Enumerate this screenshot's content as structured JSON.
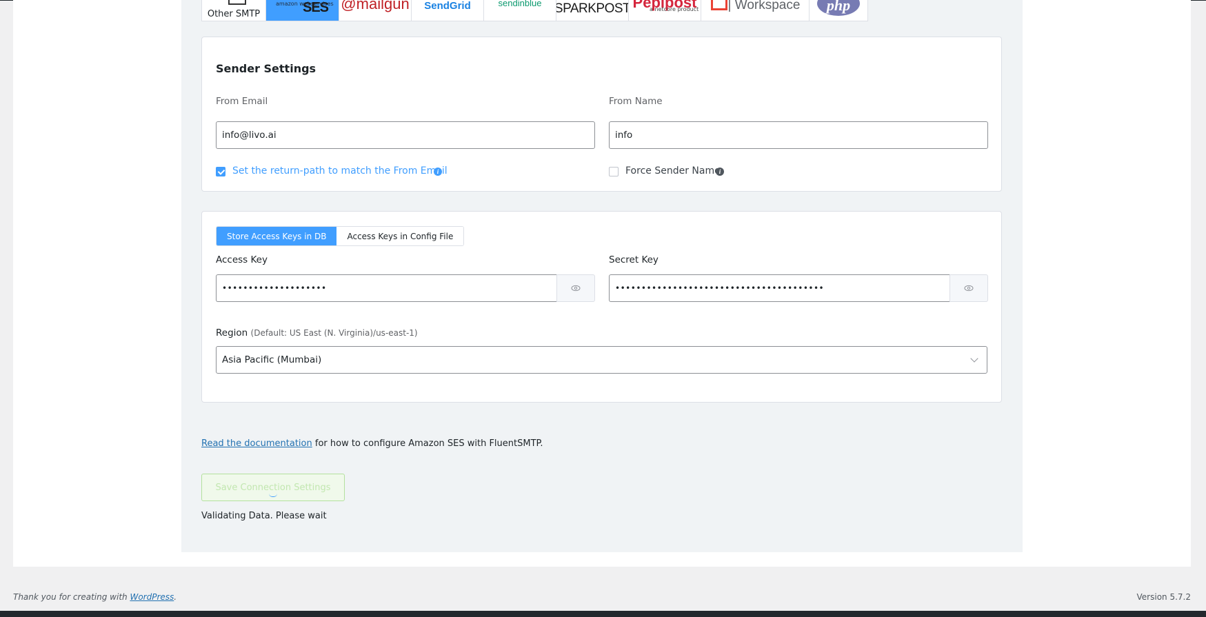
{
  "providers": [
    {
      "key": "other",
      "label": "Other SMTP",
      "active": false
    },
    {
      "key": "ses",
      "label": "SES",
      "sub": "amazon webservices",
      "active": true
    },
    {
      "key": "mailgun",
      "label": "@mailgun",
      "active": false
    },
    {
      "key": "sendgrid",
      "label": "SendGrid",
      "active": false
    },
    {
      "key": "sendinblue",
      "label": "sendinblue",
      "active": false
    },
    {
      "key": "sparkpost",
      "label": "SPARKPOST",
      "active": false
    },
    {
      "key": "pepipost",
      "label": "Pepipost",
      "sub": "a netcore product",
      "active": false
    },
    {
      "key": "workspace",
      "label": "| Workspace",
      "active": false
    },
    {
      "key": "php",
      "label": "php",
      "active": false
    }
  ],
  "sender": {
    "title": "Sender Settings",
    "from_email_label": "From Email",
    "from_email_value": "info@livo.ai",
    "from_name_label": "From Name",
    "from_name_value": "info",
    "return_path_label": "Set the return-path to match the From Email",
    "return_path_checked": true,
    "force_name_label": "Force Sender Name",
    "force_name_checked": false
  },
  "keys": {
    "tab_db": "Store Access Keys in DB",
    "tab_config": "Access Keys in Config File",
    "access_key_label": "Access Key",
    "access_key_value": "••••••••••••••••••••",
    "secret_key_label": "Secret Key",
    "secret_key_value": "••••••••••••••••••••••••••••••••••••••••",
    "region_label": "Region",
    "region_hint": "(Default: US East (N. Virginia)/us-east-1)",
    "region_value": "Asia Pacific (Mumbai)"
  },
  "doc": {
    "link_text": "Read the documentation",
    "rest_text": " for how to configure Amazon SES with FluentSMTP."
  },
  "save_button": "Save Connection Settings",
  "status_text": "Validating Data. Please wait",
  "footer": {
    "thanks_prefix": "Thank you for creating with ",
    "wp_link": "WordPress",
    "thanks_suffix": ".",
    "version": "Version 5.7.2"
  },
  "colors": {
    "accent": "#409eff",
    "link": "#2271b1",
    "success_light": "#f0f9eb"
  }
}
